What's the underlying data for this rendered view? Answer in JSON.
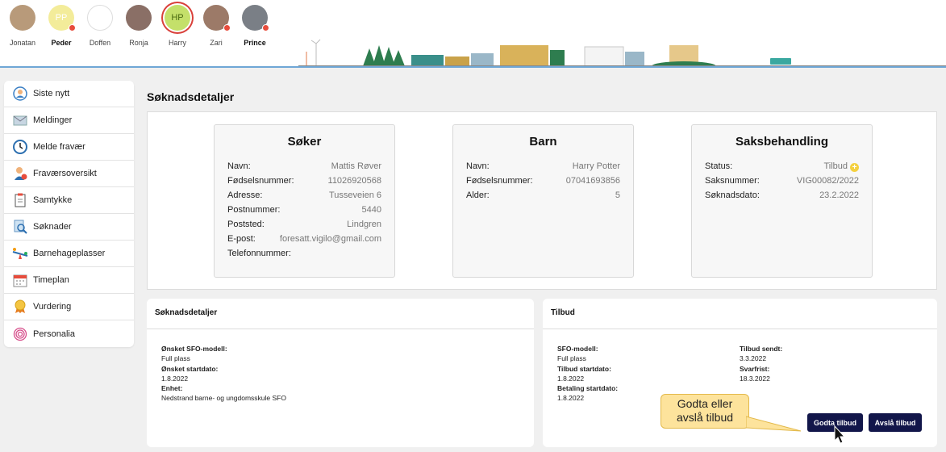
{
  "users": [
    {
      "name": "Jonatan",
      "initials": "",
      "color": "#b89a7a",
      "dot": false,
      "selected": false,
      "bold": false
    },
    {
      "name": "Peder",
      "initials": "PP",
      "color": "#f3ec9a",
      "dot": true,
      "selected": false,
      "bold": true
    },
    {
      "name": "Doffen",
      "initials": "",
      "color": "#ffffff",
      "dot": false,
      "selected": false,
      "bold": false
    },
    {
      "name": "Ronja",
      "initials": "",
      "color": "#8a6f66",
      "dot": false,
      "selected": false,
      "bold": false
    },
    {
      "name": "Harry",
      "initials": "HP",
      "color": "#c4e06a",
      "dot": false,
      "selected": true,
      "bold": false
    },
    {
      "name": "Zari",
      "initials": "",
      "color": "#9c7a68",
      "dot": true,
      "selected": false,
      "bold": false
    },
    {
      "name": "Prince",
      "initials": "",
      "color": "#7a7f86",
      "dot": true,
      "selected": false,
      "bold": true
    }
  ],
  "sidebar": {
    "items": [
      {
        "label": "Siste nytt",
        "icon": "news-icon"
      },
      {
        "label": "Meldinger",
        "icon": "envelope-icon"
      },
      {
        "label": "Melde fravær",
        "icon": "clock-icon"
      },
      {
        "label": "Fraværsoversikt",
        "icon": "person-absence-icon"
      },
      {
        "label": "Samtykke",
        "icon": "clipboard-icon"
      },
      {
        "label": "Søknader",
        "icon": "search-document-icon"
      },
      {
        "label": "Barnehageplasser",
        "icon": "seesaw-icon"
      },
      {
        "label": "Timeplan",
        "icon": "calendar-icon"
      },
      {
        "label": "Vurdering",
        "icon": "medal-icon"
      },
      {
        "label": "Personalia",
        "icon": "fingerprint-icon"
      }
    ]
  },
  "page": {
    "title": "Søknadsdetaljer"
  },
  "soker": {
    "title": "Søker",
    "rows": [
      {
        "k": "Navn:",
        "v": "Mattis Røver"
      },
      {
        "k": "Fødselsnummer:",
        "v": "11026920568"
      },
      {
        "k": "Adresse:",
        "v": "Tusseveien 6"
      },
      {
        "k": "Postnummer:",
        "v": "5440"
      },
      {
        "k": "Poststed:",
        "v": "Lindgren"
      },
      {
        "k": "E-post:",
        "v": "foresatt.vigilo@gmail.com"
      },
      {
        "k": "Telefonnummer:",
        "v": ""
      }
    ]
  },
  "barn": {
    "title": "Barn",
    "rows": [
      {
        "k": "Navn:",
        "v": "Harry Potter"
      },
      {
        "k": "Fødselsnummer:",
        "v": "07041693856"
      },
      {
        "k": "Alder:",
        "v": "5"
      }
    ]
  },
  "saks": {
    "title": "Saksbehandling",
    "status_label": "Status:",
    "status_value": "Tilbud",
    "rows": [
      {
        "k": "Saksnummer:",
        "v": "VIG00082/2022"
      },
      {
        "k": "Søknadsdato:",
        "v": "23.2.2022"
      }
    ]
  },
  "details_panel": {
    "title": "Søknadsdetaljer",
    "model_label": "Ønsket SFO-modell:",
    "model_value": "Full plass",
    "start_label": "Ønsket startdato:",
    "start_value": "1.8.2022",
    "unit_label": "Enhet:",
    "unit_value": "Nedstrand barne- og ungdomsskule SFO"
  },
  "offer_panel": {
    "title": "Tilbud",
    "model_label": "SFO-modell:",
    "model_value": "Full plass",
    "start_label": "Tilbud startdato:",
    "start_value": "1.8.2022",
    "pay_label": "Betaling startdato:",
    "pay_value": "1.8.2022",
    "sent_label": "Tilbud sendt:",
    "sent_value": "3.3.2022",
    "deadline_label": "Svarfrist:",
    "deadline_value": "18.3.2022",
    "accept_label": "Godta tilbud",
    "reject_label": "Avslå tilbud"
  },
  "callout": {
    "line1": "Godta eller",
    "line2": "avslå tilbud"
  },
  "colors": {
    "accent": "#12164a",
    "badge": "#f4d03f",
    "dot": "#e74c3c"
  }
}
